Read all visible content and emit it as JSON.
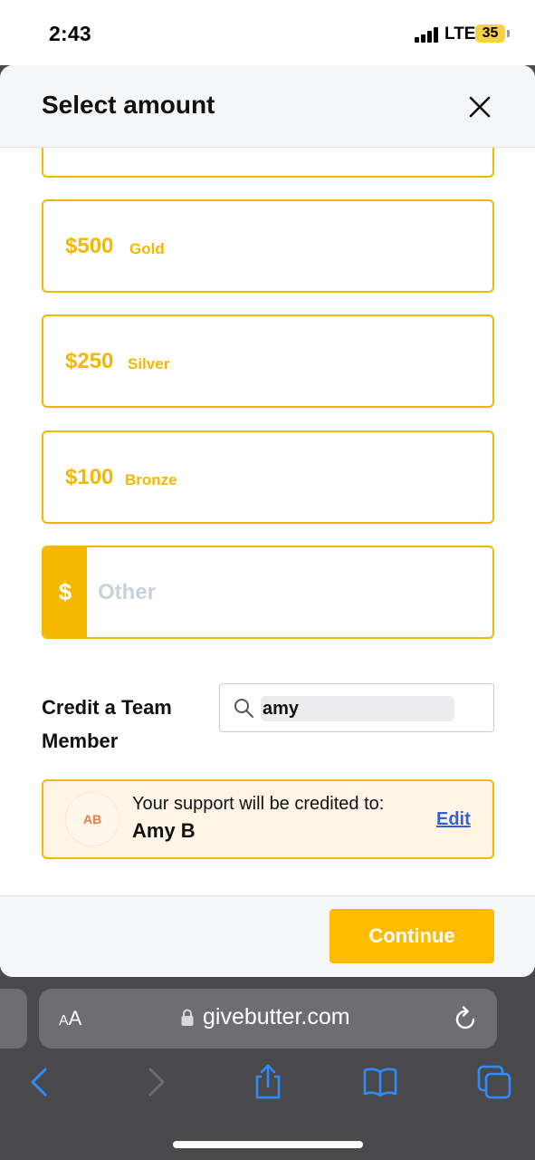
{
  "status_bar": {
    "time": "2:43",
    "network": "LTE",
    "battery": "35"
  },
  "sheet": {
    "title": "Select amount"
  },
  "amounts": [
    {
      "value": "$500",
      "tier": "Gold"
    },
    {
      "value": "$250",
      "tier": "Silver"
    },
    {
      "value": "$100",
      "tier": "Bronze"
    }
  ],
  "other": {
    "prefix": "$",
    "placeholder": "Other"
  },
  "credit": {
    "label": "Credit a Team Member",
    "search_value": "amy",
    "support_text": "Your support will be credited to:",
    "member_name": "Amy B",
    "avatar_initials": "AB",
    "edit_label": "Edit"
  },
  "footer": {
    "continue_label": "Continue"
  },
  "browser": {
    "text_size_label_small": "A",
    "text_size_label_large": "A",
    "url": "givebutter.com"
  },
  "colors": {
    "accent": "#f5b800",
    "button": "#ffbb00",
    "link": "#2f62d9"
  }
}
